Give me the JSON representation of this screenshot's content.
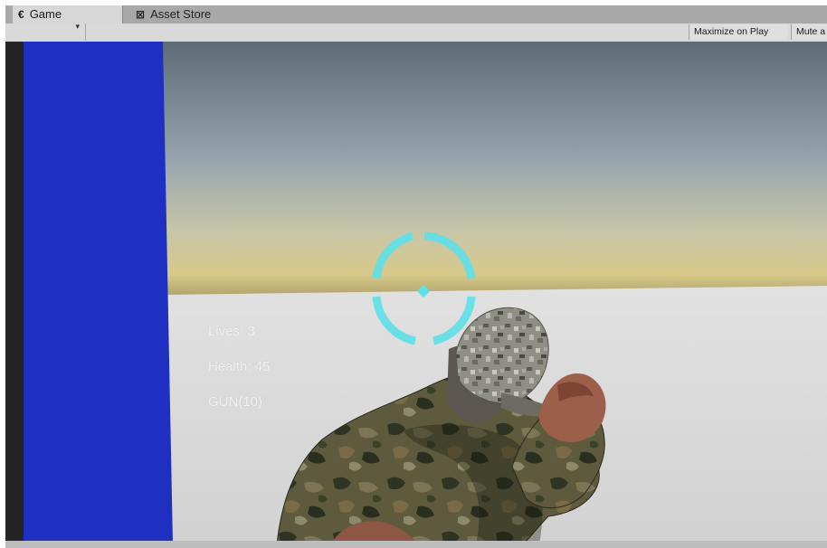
{
  "tabs": [
    {
      "label": "Game",
      "icon": "game-icon"
    },
    {
      "label": "Asset Store",
      "icon": "asset-store-icon"
    }
  ],
  "toolbar": {
    "display_arrow": "▾",
    "maximize_label": "Maximize on Play",
    "mute_label": "Mute a"
  },
  "hud": {
    "lives": "Lives: 3",
    "health": "Health: 45",
    "weapon": "GUN(10)"
  },
  "colors": {
    "wall": "#1f2fc2",
    "crosshair": "#5ee0ea",
    "sky_top": "#5f6e79",
    "horizon": "#d9c98a",
    "ground": "#d6d6d6"
  },
  "icons": [
    "game-icon",
    "asset-store-icon",
    "chevron-down-icon",
    "crosshair-icon"
  ]
}
